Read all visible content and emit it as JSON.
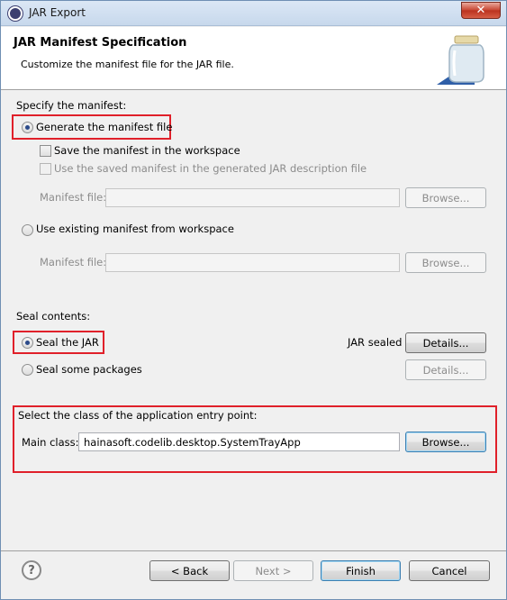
{
  "window": {
    "title": "JAR Export",
    "close_label": "✕"
  },
  "header": {
    "title": "JAR Manifest Specification",
    "description": "Customize the manifest file for the JAR file."
  },
  "manifest": {
    "section_label": "Specify the manifest:",
    "generate_label": "Generate the manifest file",
    "save_label": "Save the manifest in the workspace",
    "use_saved_label": "Use the saved manifest in the generated JAR description file",
    "manifest_file_label": "Manifest file:",
    "browse_label": "Browse...",
    "use_existing_label": "Use existing manifest from workspace",
    "generate_selected": true
  },
  "seal": {
    "section_label": "Seal contents:",
    "seal_jar_label": "Seal the JAR",
    "seal_some_label": "Seal some packages",
    "jar_sealed_label": "JAR sealed",
    "details_label": "Details..."
  },
  "entry": {
    "section_label": "Select the class of the application entry point:",
    "main_class_label": "Main class:",
    "main_class_value": "hainasoft.codelib.desktop.SystemTrayApp",
    "browse_label": "Browse..."
  },
  "footer": {
    "help_glyph": "?",
    "back_label": "< Back",
    "next_label": "Next >",
    "finish_label": "Finish",
    "cancel_label": "Cancel"
  },
  "colors": {
    "highlight_box": "#e0202a",
    "radio_dot": "#2b4a8a"
  },
  "icons": {
    "app": "eclipse-icon",
    "banner": "jar-icon",
    "help": "help-icon"
  }
}
